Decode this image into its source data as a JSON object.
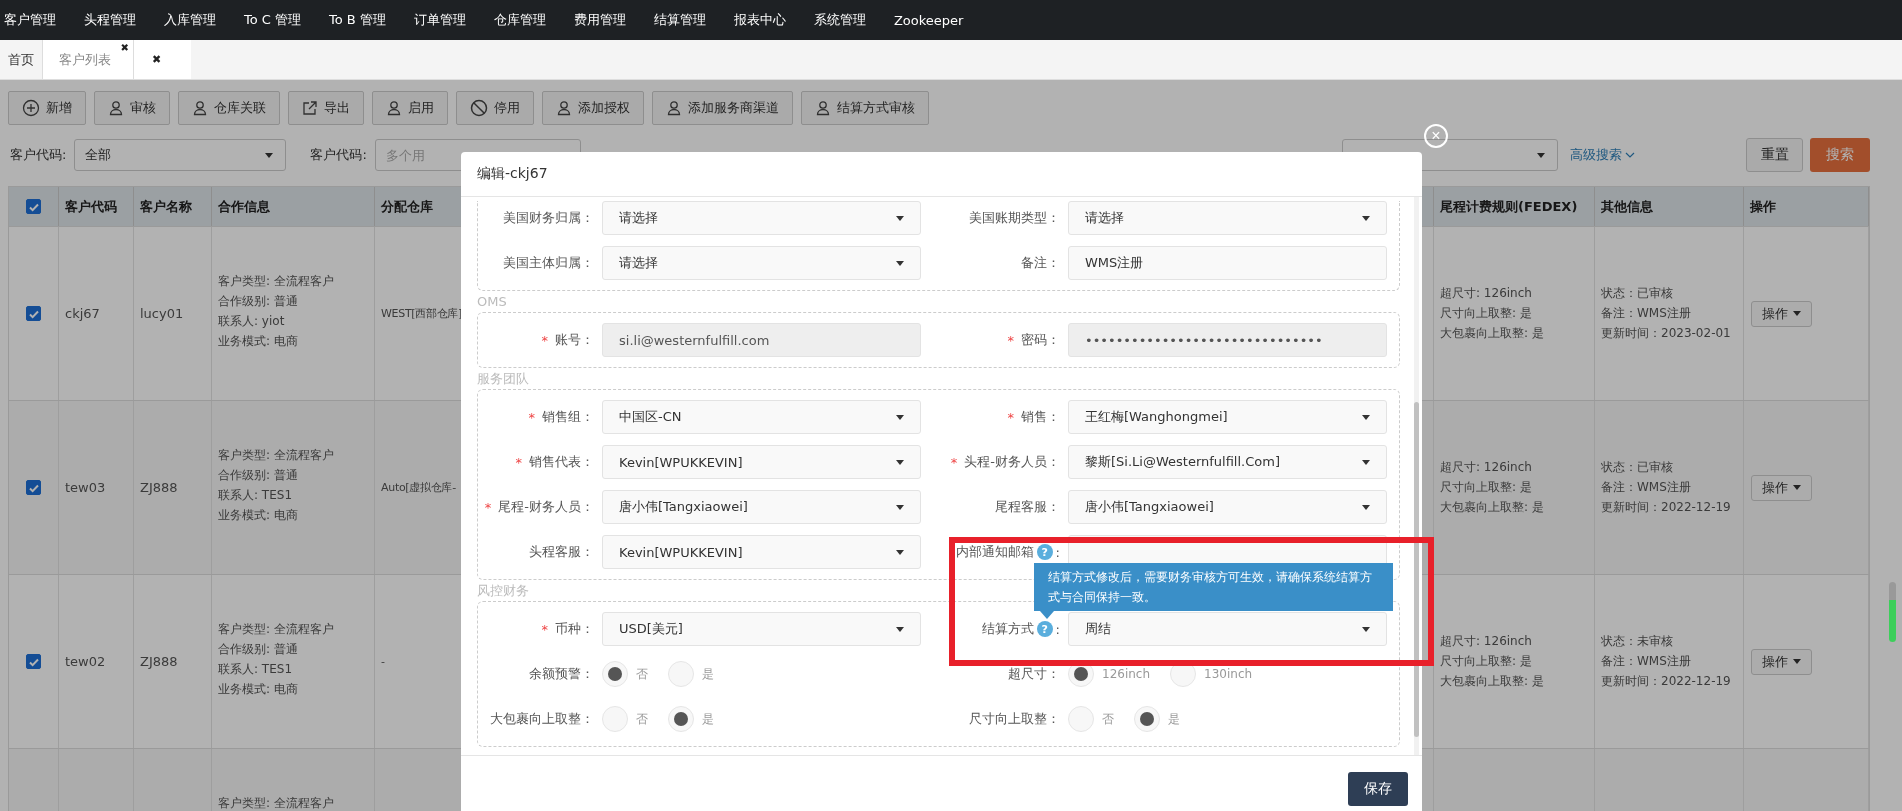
{
  "top_nav": {
    "items": [
      "客户管理",
      "头程管理",
      "入库管理",
      "To C 管理",
      "To B 管理",
      "订单管理",
      "仓库管理",
      "费用管理",
      "结算管理",
      "报表中心",
      "系统管理",
      "Zookeeper"
    ]
  },
  "tabs": [
    {
      "label": "首页",
      "selected": false
    },
    {
      "label": "客户列表",
      "selected": true,
      "close": "✖"
    }
  ],
  "tabs_close_all": "✖",
  "toolbar": {
    "buttons": [
      "新增",
      "审核",
      "仓库关联",
      "导出",
      "启用",
      "停用",
      "添加授权",
      "添加服务商渠道",
      "结算方式审核"
    ]
  },
  "filters": {
    "code_label": "客户代码:",
    "code_value": "全部",
    "codes_label": "客户代码:",
    "codes_placeholder": "多个用",
    "advanced_search": "高级搜索",
    "reset": "重置",
    "search": "搜索"
  },
  "table": {
    "all_selected": true,
    "columns": [
      "客户代码",
      "客户名称",
      "合作信息",
      "分配仓库",
      "尾程计费规则(FEDEX)",
      "其他信息",
      "操作"
    ],
    "rows": [
      {
        "selected": true,
        "code": "ckj67",
        "name": "lucy01",
        "info": [
          "客户类型: 全流程客户",
          "合作级别: 普通",
          "联系人: yiot",
          "业务模式: 电商"
        ],
        "warehouse": "WEST[西部仓库]",
        "fee_rules": [
          "超尺寸: 126inch",
          "尺寸向上取整: 是",
          "大包裹向上取整: 是"
        ],
        "other": [
          "状态：已审核",
          "备注：WMS注册",
          "更新时间：2023-02-01"
        ],
        "action": "操作"
      },
      {
        "selected": true,
        "code": "tew03",
        "name": "ZJ888",
        "info": [
          "客户类型: 全流程客户",
          "合作级别: 普通",
          "联系人: TES1",
          "业务模式: 电商"
        ],
        "warehouse": "Auto[虚拟仓库-",
        "fee_rules": [
          "超尺寸: 126inch",
          "尺寸向上取整: 是",
          "大包裹向上取整: 是"
        ],
        "other": [
          "状态：已审核",
          "备注：WMS注册",
          "更新时间：2022-12-19"
        ],
        "action": "操作"
      },
      {
        "selected": true,
        "code": "tew02",
        "name": "ZJ888",
        "info": [
          "客户类型: 全流程客户",
          "合作级别: 普通",
          "联系人: TES1",
          "业务模式: 电商"
        ],
        "warehouse": "-",
        "fee_rules": [
          "超尺寸: 126inch",
          "尺寸向上取整: 是",
          "大包裹向上取整: 是"
        ],
        "other": [
          "状态：未审核",
          "备注：WMS注册",
          "更新时间：2022-12-19"
        ],
        "action": "操作"
      },
      {
        "info": [
          "客户类型: 全流程客户"
        ]
      }
    ]
  },
  "modal": {
    "title": "编辑-ckj67",
    "close": "×",
    "save": "保存",
    "sections": [
      {
        "fields": [
          {
            "kind": "select",
            "label": "美国财务归属：",
            "required": false,
            "value": "请选择"
          },
          {
            "kind": "select",
            "label": "美国账期类型：",
            "required": false,
            "value": "请选择"
          },
          {
            "kind": "select",
            "label": "美国主体归属：",
            "required": false,
            "value": "请选择"
          },
          {
            "kind": "input",
            "label": "备注：",
            "required": false,
            "value": "WMS注册"
          }
        ]
      },
      {
        "legend": "OMS",
        "fields": [
          {
            "kind": "readonly",
            "label": "账号：",
            "required": "*",
            "value": "si.li@westernfulfill.com"
          },
          {
            "kind": "readonly",
            "label": "密码：",
            "required": "*",
            "value": "•••••••••••••••••••••••••••••••"
          }
        ]
      },
      {
        "legend": "服务团队",
        "fields": [
          {
            "kind": "select",
            "label": "销售组：",
            "required": "*",
            "value": "中国区-CN"
          },
          {
            "kind": "select",
            "label": "销售：",
            "required": "*",
            "value": "王红梅[Wanghongmei]"
          },
          {
            "kind": "select",
            "label": "销售代表：",
            "required": "*",
            "value": "Kevin[WPUKKEVIN]"
          },
          {
            "kind": "select",
            "label": "头程-财务人员：",
            "required": "*",
            "value": "黎斯[Si.Li@Westernfulfill.Com]"
          },
          {
            "kind": "select",
            "label": "尾程-财务人员：",
            "required": "*",
            "value": "唐小伟[Tangxiaowei]"
          },
          {
            "kind": "select",
            "label": "尾程客服：",
            "required": false,
            "value": "唐小伟[Tangxiaowei]"
          },
          {
            "kind": "select",
            "label": "头程客服：",
            "required": false,
            "value": "Kevin[WPUKKEVIN]"
          },
          {
            "kind": "input",
            "label": "内部通知邮箱",
            "required": false,
            "help": "?",
            "suffix": ":"
          }
        ]
      },
      {
        "legend": "风控财务",
        "fields": [
          {
            "kind": "select",
            "label": "币种：",
            "required": "*",
            "value": "USD[美元]"
          },
          {
            "kind": "select",
            "label": "结算方式",
            "required": false,
            "help": "?",
            "suffix": ":",
            "tooltip": "结算方式修改后，需要财务审核方可生效，请确保系统结算方式与合同保持一致。",
            "value": "周结"
          },
          {
            "kind": "radio",
            "label": "余额预警：",
            "required": false,
            "options": [
              {
                "label": "否",
                "selected": true
              },
              {
                "label": "是",
                "selected": false
              }
            ]
          },
          {
            "kind": "radio",
            "label": "超尺寸：",
            "required": false,
            "options": [
              {
                "label": "126inch",
                "selected": true
              },
              {
                "label": "130inch",
                "selected": false
              }
            ]
          },
          {
            "kind": "radio",
            "label": "大包裹向上取整：",
            "required": false,
            "options": [
              {
                "label": "否",
                "selected": false
              },
              {
                "label": "是",
                "selected": true
              }
            ]
          },
          {
            "kind": "radio",
            "label": "尺寸向上取整：",
            "required": false,
            "options": [
              {
                "label": "否",
                "selected": false
              },
              {
                "label": "是",
                "selected": true
              }
            ]
          }
        ]
      }
    ]
  }
}
